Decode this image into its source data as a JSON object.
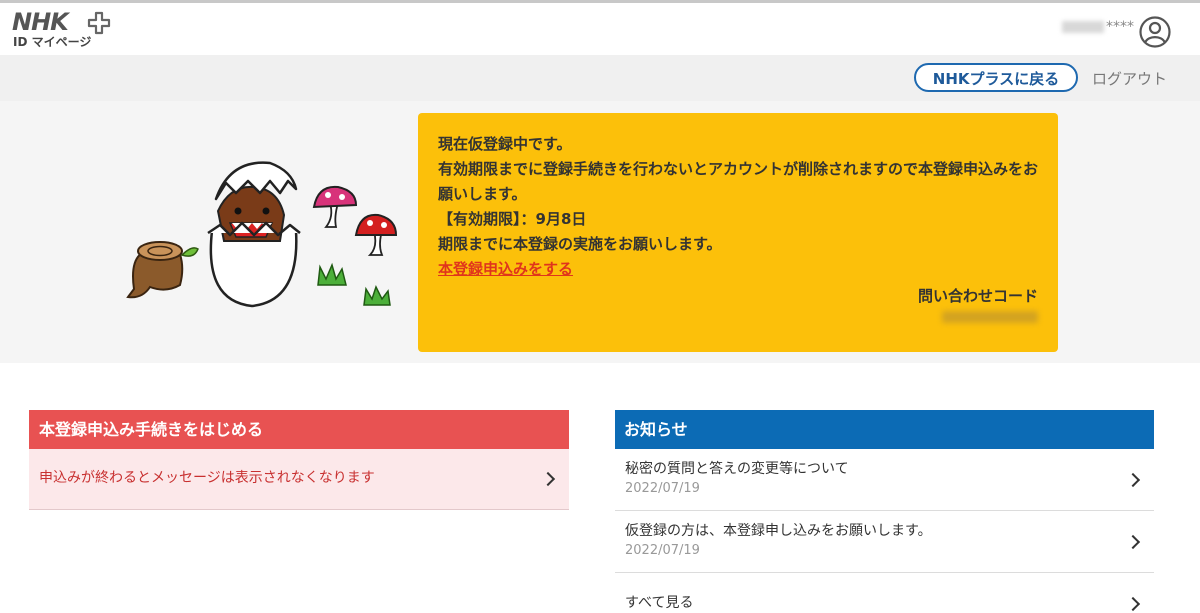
{
  "header": {
    "logo_text": "NHK",
    "logo_sub": "ID マイページ",
    "username_suffix": "****"
  },
  "nav": {
    "back_label": "NHKプラスに戻る",
    "logout_label": "ログアウト"
  },
  "notice": {
    "lines": [
      "現在仮登録中です。",
      "有効期限までに登録手続きを行わないとアカウントが削除されますので本登録申込みをお願いします。",
      "【有効期限】：9月8日",
      "期限までに本登録の実施をお願いします。"
    ],
    "link_label": "本登録申込みをする",
    "inquiry_label": "問い合わせコード",
    "colors": {
      "background": "#fcc00a",
      "link": "#e0351c"
    }
  },
  "registration_card": {
    "title": "本登録申込み手続きをはじめる",
    "item": "申込みが終わるとメッセージは表示されなくなります",
    "colors": {
      "header": "#e85252",
      "body": "#fce8ea",
      "text": "#c83030"
    }
  },
  "news": {
    "title": "お知らせ",
    "items": [
      {
        "title": "秘密の質問と答えの変更等について",
        "date": "2022/07/19"
      },
      {
        "title": "仮登録の方は、本登録申し込みをお願いします。",
        "date": "2022/07/19"
      }
    ],
    "see_all": "すべて見る",
    "colors": {
      "header": "#0c6bb5"
    }
  },
  "icons": [
    "nhk-plus-logo-icon",
    "user-avatar-icon",
    "chevron-right-icon",
    "domo-egg-illustration"
  ]
}
